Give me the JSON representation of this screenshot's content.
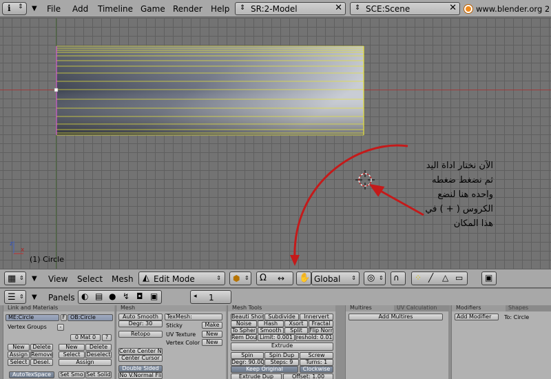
{
  "menubar": {
    "items": [
      "File",
      "Add",
      "Timeline",
      "Game",
      "Render",
      "Help"
    ],
    "screen_field": "SR:2-Model",
    "scene_field": "SCE:Scene",
    "url": "www.blender.org 2"
  },
  "viewport": {
    "object_label": "(1) Circle",
    "annotation": "الآن نختار اداة اليد\nثم نضغط ضغطه\nواحده هنا لنضع\nالكروس ( + ) في\nهذا المكان"
  },
  "header3d": {
    "menus": [
      "View",
      "Select",
      "Mesh"
    ],
    "mode": "Edit Mode",
    "orientation": "Global"
  },
  "buttons_header": {
    "panels_label": "Panels",
    "frame": "1"
  },
  "panels": {
    "link": {
      "title": "Link and Materials",
      "me_field": "ME:Circle",
      "f_label": "F",
      "ob_field": "OB:Circle",
      "vertex_groups": "Vertex Groups",
      "mat_field": "0 Mat 0",
      "q": "?",
      "new": "New",
      "delete": "Delete",
      "assign": "Assign",
      "remove": "Remove",
      "select": "Select",
      "desel": "Desel.",
      "new2": "New",
      "delete2": "Delete",
      "select2": "Select",
      "deselect2": "Deselect",
      "assign2": "Assign",
      "autotexspace": "AutoTexSpace",
      "set_smo": "Set Smo",
      "set_solid": "Set Solid"
    },
    "mesh": {
      "title": "Mesh",
      "auto_smooth": "Auto Smooth",
      "degr": "Degr: 30",
      "retopo": "Retopo",
      "center_new": "Cente Center Ne",
      "center_cursor": "Center Cursor",
      "double_sided": "Double Sided",
      "no_vnormal": "No V.Normal Fli",
      "texmesh": "TexMesh:",
      "sticky": "Sticky",
      "make": "Make",
      "uv_texture": "UV Texture",
      "new1": "New",
      "vertex_color": "Vertex Color",
      "new2": "New"
    },
    "tools": {
      "title": "Mesh Tools",
      "beauty_short": "Beauti Short",
      "subdivide": "Subdivide",
      "innervert": "Innervert",
      "noise": "Noise",
      "hash": "Hash",
      "xsort": "Xsort",
      "fractal": "Fractal",
      "to_sphere": "To Spher",
      "smooth": "Smooth",
      "split": "Split",
      "flip_norm": "Flip Norm",
      "rem_dou": "Rem Dou",
      "limit": "Limit: 0.001",
      "threshold": "reshold: 0.010",
      "extrude": "Extrude",
      "spin": "Spin",
      "spin_dup": "Spin Dup",
      "screw": "Screw",
      "degr": "Degr: 90.00",
      "steps": "Steps: 9",
      "turns": "Turns: 1",
      "keep_original": "Keep Original",
      "clockwise": "Clockwise",
      "extrude_dup": "Extrude Dup",
      "offset": "Offset: 1.00"
    },
    "multires": {
      "title": "Multires",
      "tab2": "UV Calculation",
      "add": "Add Multires"
    },
    "modifiers": {
      "title": "Modifiers",
      "tab2": "Shapes",
      "add": "Add Modifier",
      "to": "To: Circle"
    }
  },
  "colors": {
    "select_yellow": "#e6e23a",
    "edge_pink": "#e060e0",
    "arrow_red": "#c41a1a",
    "grid": "#5f5f5f",
    "axis_x": "#a03a3a"
  }
}
